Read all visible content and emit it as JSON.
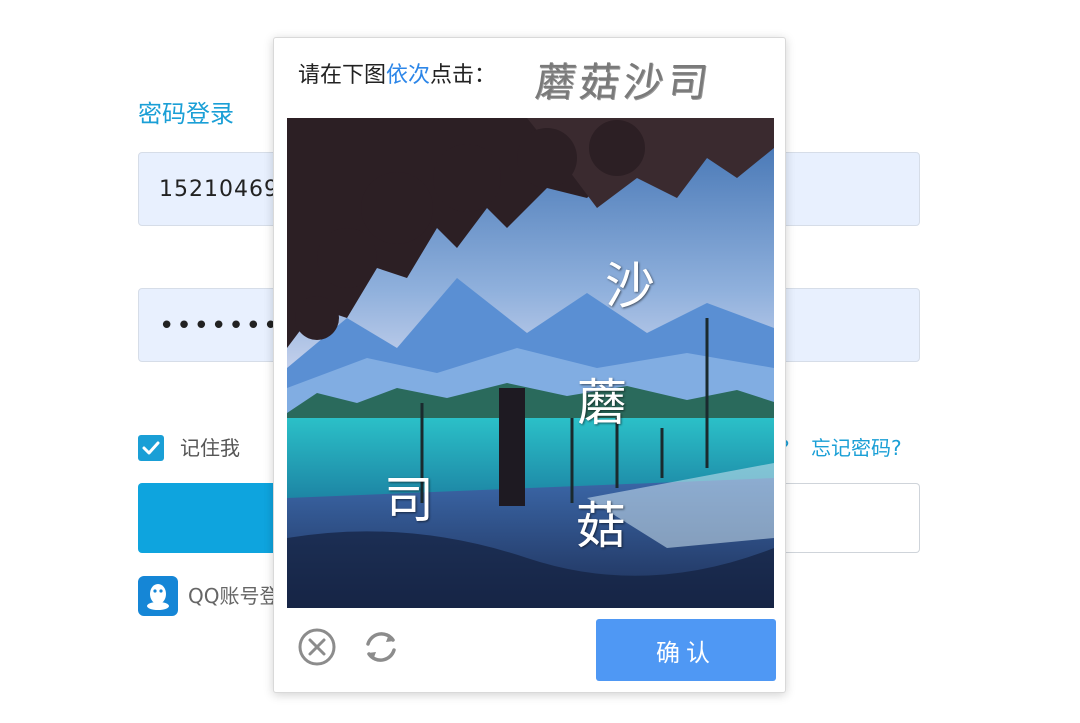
{
  "login": {
    "title": "密码登录",
    "username_value": "15210469",
    "password_value": "•••••••••",
    "remember_label": "记住我",
    "remember_checked": true,
    "forgot_qmark": "?",
    "forgot_label": "忘记密码?",
    "qq_label": "QQ账号登"
  },
  "captcha": {
    "prompt_prefix": "请在下图",
    "prompt_accent": "依次",
    "prompt_suffix": "点击：",
    "target_chars": "蘑菇沙司",
    "image_chars": [
      "沙",
      "蘑",
      "司",
      "菇"
    ],
    "close_icon": "close-circle-icon",
    "refresh_icon": "refresh-icon",
    "confirm_label": "确认"
  },
  "colors": {
    "accent": "#1a9fd6",
    "confirm": "#4f98f4",
    "field_bg": "#e8f0fe"
  }
}
